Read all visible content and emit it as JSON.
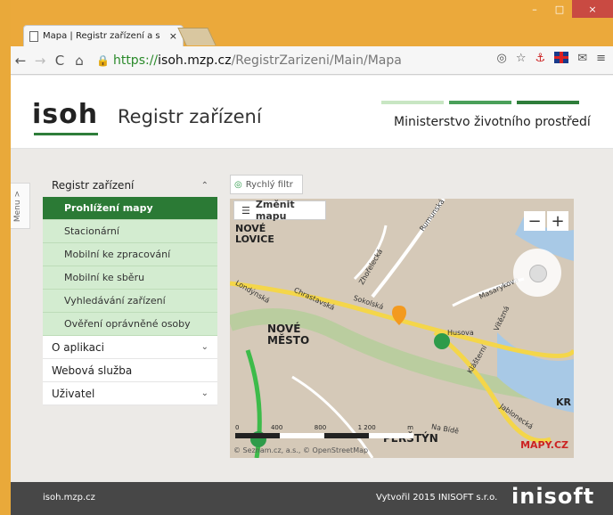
{
  "browser": {
    "tab_title": "Mapa | Registr zařízení a s",
    "tab_close": "×",
    "url_scheme": "https://",
    "url_host": "isoh.mzp.cz",
    "url_path": "/RegistrZarizeni/Main/Mapa",
    "win_min": "–",
    "win_max": "□",
    "win_close": "×"
  },
  "header": {
    "logo": "isoh",
    "app_name": "Registr zařízení",
    "ministry": "Ministerstvo životního prostředí",
    "brand_colors": [
      "#c8e6c3",
      "#4aa05a",
      "#2e7d3a"
    ]
  },
  "menu_toggle": "Menu >",
  "sidebar": {
    "group_registr": "Registr zařízení",
    "items": [
      "Prohlížení mapy",
      "Stacionární",
      "Mobilní ke zpracování",
      "Mobilní ke sběru",
      "Vyhledávání zařízení",
      "Ověření oprávněné osoby"
    ],
    "o_aplikaci": "O aplikaci",
    "webova_sluzba": "Webová služba",
    "uzivatel": "Uživatel"
  },
  "map": {
    "quick_filter": "Rychlý filtr",
    "change_map": "Změnit mapu",
    "zoom_out": "−",
    "zoom_in": "+",
    "labels": [
      "NOVÉ LOVICE",
      "NOVÉ MĚSTO",
      "PERŠTÝN",
      "Rumunská",
      "Sokolská",
      "Chrastavská",
      "Zhořelecká",
      "Masarykova",
      "Jablonecká",
      "Na Bídě",
      "Husova",
      "Klášterní",
      "Vítězná",
      "Londýnská",
      "KR"
    ],
    "scale_labels": [
      "0",
      "400",
      "800",
      "1 200",
      "m"
    ],
    "brand": "MAPY.CZ",
    "copyright": "© Seznam.cz, a.s., © OpenStreetMap"
  },
  "footer": {
    "left": "isoh.mzp.cz",
    "right": "Vytvořil 2015 INISOFT s.r.o.",
    "logo": "inisoft"
  }
}
